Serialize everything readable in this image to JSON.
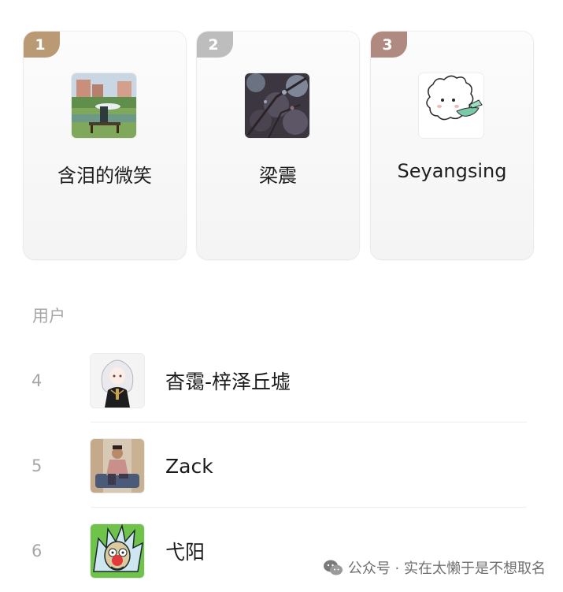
{
  "podium": [
    {
      "rank": "1",
      "name": "含泪的微笑",
      "badge_color": "#b99a74"
    },
    {
      "rank": "2",
      "name": "梁震",
      "badge_color": "#bdbdbd"
    },
    {
      "rank": "3",
      "name": "Seyangsing",
      "badge_color": "#b08a80"
    }
  ],
  "section": {
    "label": "用户"
  },
  "list": [
    {
      "rank": "4",
      "name": "杳霭-梓泽丘墟"
    },
    {
      "rank": "5",
      "name": "Zack"
    },
    {
      "rank": "6",
      "name": "弋阳"
    }
  ],
  "watermark": {
    "text": "公众号 · 实在太懒于是不想取名",
    "icon": "wechat-icon"
  }
}
